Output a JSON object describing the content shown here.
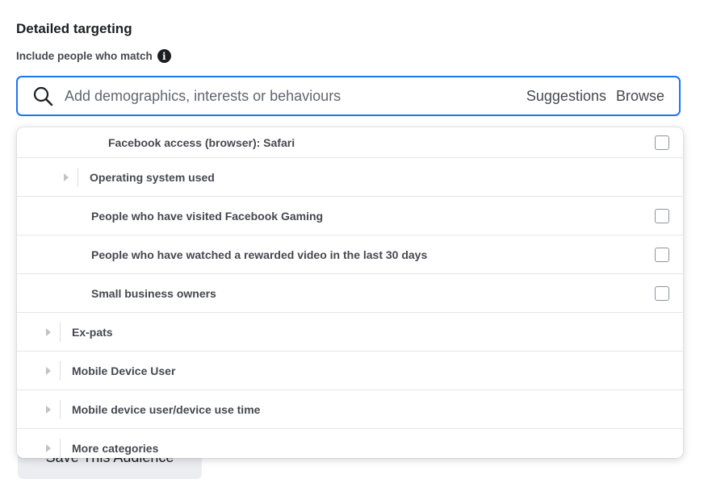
{
  "section": {
    "title": "Detailed targeting",
    "subtitle": "Include people who match"
  },
  "search": {
    "placeholder": "Add demographics, interests or behaviours",
    "suggestions_label": "Suggestions",
    "browse_label": "Browse"
  },
  "save_button": "Save This Audience",
  "dropdown": {
    "items": [
      {
        "label": "Facebook access (browser): Safari",
        "type": "checkbox"
      },
      {
        "label": "Operating system used",
        "type": "expandable"
      },
      {
        "label": "People who have visited Facebook Gaming",
        "type": "checkbox"
      },
      {
        "label": "People who have watched a rewarded video in the last 30 days",
        "type": "checkbox"
      },
      {
        "label": "Small business owners",
        "type": "checkbox"
      },
      {
        "label": "Ex-pats",
        "type": "expandable"
      },
      {
        "label": "Mobile Device User",
        "type": "expandable"
      },
      {
        "label": "Mobile device user/device use time",
        "type": "expandable"
      },
      {
        "label": "More categories",
        "type": "expandable"
      }
    ]
  },
  "colors": {
    "accent": "#1877f2",
    "text": "#1c1e21",
    "muted": "#444950"
  }
}
